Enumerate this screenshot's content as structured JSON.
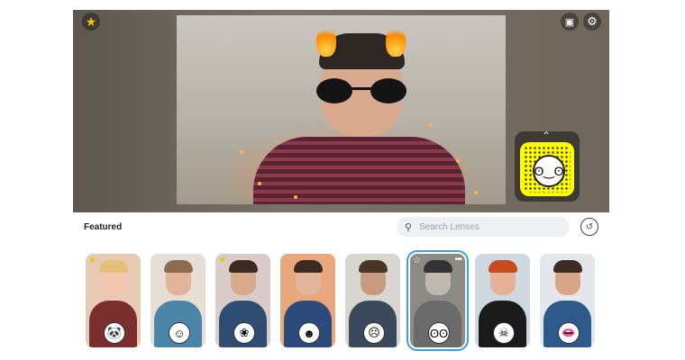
{
  "preview": {
    "star_icon": "★",
    "twitch_icon": "▣",
    "settings_icon": "⚙",
    "snapcode_chevron": "⌃",
    "snapcode_face": "ʘ‿ʘ"
  },
  "panel": {
    "section_title": "Featured",
    "search_placeholder": "Search Lenses",
    "search_icon": "⚲",
    "history_icon": "↺"
  },
  "lenses": [
    {
      "name": "panda-lens",
      "badge": "🐼",
      "favorite": true,
      "selected": false,
      "bg": "#e8c9b3",
      "skin": "#f1c7b0",
      "hair": "#e4c07a",
      "shirt": "#7a2e2e"
    },
    {
      "name": "ghost-lens",
      "badge": "☺",
      "favorite": false,
      "selected": false,
      "bg": "#e6ddd5",
      "skin": "#e3b49a",
      "hair": "#8c6b4e",
      "shirt": "#4b86a8"
    },
    {
      "name": "flower-crown-lens",
      "badge": "❀",
      "favorite": true,
      "selected": false,
      "bg": "#d9cbc7",
      "skin": "#d8a98c",
      "hair": "#3c2b22",
      "shirt": "#2f4d72"
    },
    {
      "name": "smile-lens",
      "badge": "☻",
      "favorite": false,
      "selected": false,
      "bg": "#e9a77e",
      "skin": "#e2b49a",
      "hair": "#3a2a22",
      "shirt": "#2c4a7a"
    },
    {
      "name": "cartoon-lens",
      "badge": "☹",
      "favorite": false,
      "selected": false,
      "bg": "#d9d6cf",
      "skin": "#c79a80",
      "hair": "#4a3628",
      "shirt": "#3a4a5c"
    },
    {
      "name": "twin-faces-lens",
      "badge": "ʘʘ",
      "favorite": true,
      "selected": true,
      "bg": "#8c8a85",
      "skin": "#bdb8b0",
      "hair": "#333333",
      "shirt": "#6b6b6b"
    },
    {
      "name": "skull-mask-lens",
      "badge": "☠",
      "favorite": false,
      "selected": false,
      "bg": "#cfd7e0",
      "skin": "#e8b095",
      "hair": "#c84a1e",
      "shirt": "#1a1a1a"
    },
    {
      "name": "mustache-lens",
      "badge": "👄",
      "favorite": false,
      "selected": false,
      "bg": "#e3e6ea",
      "skin": "#d7a688",
      "hair": "#3d2c22",
      "shirt": "#2e5a8a"
    }
  ],
  "colors": {
    "accent": "#3aa0e0",
    "star": "#f5c400",
    "snapcode": "#fffc00"
  }
}
